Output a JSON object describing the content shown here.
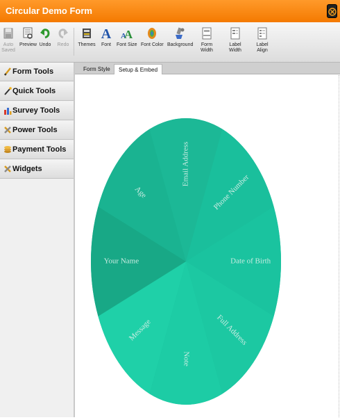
{
  "window": {
    "title": "Circular Demo Form"
  },
  "toolbar": {
    "items": [
      {
        "name": "auto-saved",
        "label": "Auto\nSaved",
        "dim": true
      },
      {
        "name": "preview",
        "label": "Preview"
      },
      {
        "name": "undo",
        "label": "Undo"
      },
      {
        "name": "redo",
        "label": "Redo",
        "dim": true
      },
      {
        "name": "themes",
        "label": "Themes"
      },
      {
        "name": "font",
        "label": "Font"
      },
      {
        "name": "font-size",
        "label": "Font Size"
      },
      {
        "name": "font-color",
        "label": "Font Color"
      },
      {
        "name": "background",
        "label": "Background"
      },
      {
        "name": "form-width",
        "label": "Form\nWidth"
      },
      {
        "name": "label-width",
        "label": "Label\nWidth"
      },
      {
        "name": "label-align",
        "label": "Label\nAlign"
      }
    ]
  },
  "sidebar": {
    "items": [
      {
        "label": "Form Tools",
        "icon": "pencil-icon"
      },
      {
        "label": "Quick Tools",
        "icon": "wand-icon"
      },
      {
        "label": "Survey Tools",
        "icon": "bar-chart-icon"
      },
      {
        "label": "Power Tools",
        "icon": "wrench-icon"
      },
      {
        "label": "Payment Tools",
        "icon": "coins-icon"
      },
      {
        "label": "Widgets",
        "icon": "tools-icon"
      }
    ]
  },
  "tabs": [
    {
      "label": "Form Style",
      "active": false
    },
    {
      "label": "Setup & Embed",
      "active": true
    }
  ],
  "form": {
    "fields": [
      {
        "label": "Email Address",
        "color": "#1cb896"
      },
      {
        "label": "Phone Number",
        "color": "#1abf9c"
      },
      {
        "label": "Date of Birth",
        "color": "#1ac39f"
      },
      {
        "label": "Full Address",
        "color": "#1cc8a2"
      },
      {
        "label": "Note",
        "color": "#1dcca5"
      },
      {
        "label": "Message",
        "color": "#1fd0a8"
      },
      {
        "label": "Your Name",
        "color": "#18a886"
      },
      {
        "label": "Age",
        "color": "#1ab391"
      }
    ]
  },
  "colors": {
    "accent": "#f47a00",
    "wheel_base": "#1dbf9a"
  }
}
